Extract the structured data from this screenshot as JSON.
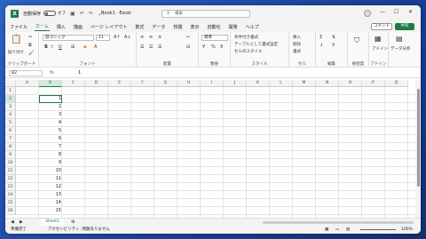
{
  "titlebar": {
    "autosave_label": "自動保存",
    "toggle_state": "オフ",
    "title": "Book1  ·  Excel",
    "search_placeholder": "検索"
  },
  "menus": [
    "ファイル",
    "ホーム",
    "挿入",
    "描画",
    "ページ レイアウト",
    "数式",
    "データ",
    "校閲",
    "表示",
    "自動化",
    "開発",
    "ヘルプ"
  ],
  "comment_label": "コメント",
  "share_label": "共有",
  "ribbon": {
    "clipboard": {
      "label": "クリップボード",
      "paste": "貼り付け"
    },
    "font": {
      "label": "フォント",
      "font_name": "游ゴシック",
      "font_size": "11"
    },
    "alignment": {
      "label": "配置"
    },
    "number": {
      "label": "数値",
      "format": "標準"
    },
    "styles": {
      "label": "スタイル",
      "cond": "条件付き書式",
      "table": "テーブルとして書式設定",
      "cell": "セルのスタイル"
    },
    "cells": {
      "label": "セル",
      "insert": "挿入",
      "delete": "削除",
      "format": "書式"
    },
    "editing": {
      "label": "編集"
    },
    "sensitivity": {
      "label": "秘密度"
    },
    "addins": {
      "label": "アドイン",
      "btn": "アドイン"
    },
    "analyze": {
      "label": "",
      "btn": "データ分析"
    }
  },
  "formula": {
    "namebox": "B2",
    "fx": "fx",
    "value": "1"
  },
  "columns": [
    "A",
    "B",
    "C",
    "D",
    "E",
    "F",
    "G",
    "H",
    "I",
    "J",
    "K",
    "L",
    "M",
    "N",
    "O",
    "P",
    "Q"
  ],
  "rows": [
    "1",
    "2",
    "3",
    "4",
    "5",
    "6",
    "7",
    "8",
    "9",
    "10",
    "11",
    "12",
    "13",
    "14",
    "15",
    "16"
  ],
  "cells_b": [
    "",
    "1",
    "2",
    "3",
    "4",
    "5",
    "6",
    "7",
    "8",
    "9",
    "10",
    "11",
    "12",
    "13",
    "14",
    "15"
  ],
  "sheet": {
    "name": "Sheet1"
  },
  "status": {
    "ready": "準備完了",
    "accessibility": "アクセシビリティ: 問題ありません",
    "zoom": "100%"
  }
}
